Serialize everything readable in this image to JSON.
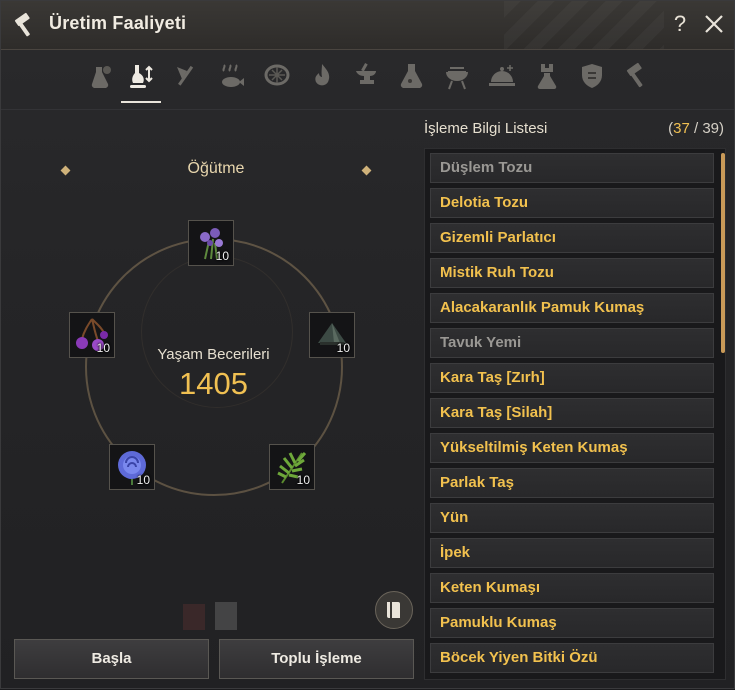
{
  "window": {
    "title": "Üretim Faaliyeti",
    "help_label": "?",
    "icon": "hammer-icon",
    "close_icon": "close-icon"
  },
  "tabs": [
    {
      "name": "simple-alchemy",
      "icon": "flask-bag-icon",
      "active": false
    },
    {
      "name": "grinding",
      "icon": "mortar-arrows-icon",
      "active": true
    },
    {
      "name": "chopping",
      "icon": "axe-icon",
      "active": false
    },
    {
      "name": "drying",
      "icon": "fish-steam-icon",
      "active": false
    },
    {
      "name": "filtering",
      "icon": "sieve-icon",
      "active": false
    },
    {
      "name": "heating",
      "icon": "flame-icon",
      "active": false
    },
    {
      "name": "repair",
      "icon": "anvil-icon",
      "active": false
    },
    {
      "name": "alchemy",
      "icon": "flask-icon",
      "active": false
    },
    {
      "name": "cooking",
      "icon": "grill-icon",
      "active": false
    },
    {
      "name": "guild-cooking",
      "icon": "cloche-icon",
      "active": false
    },
    {
      "name": "guild-alchemy",
      "icon": "tower-flask-icon",
      "active": false
    },
    {
      "name": "guild-manufacture",
      "icon": "shield-crest-icon",
      "active": false
    },
    {
      "name": "manufacture",
      "icon": "hammer-icon",
      "active": false
    }
  ],
  "process": {
    "name": "Öğütme",
    "life_skill_label": "Yaşam Becerileri",
    "life_skill_value": "1405"
  },
  "slots": [
    {
      "item": "purple-flower-sprig",
      "icon": "flower-icon",
      "qty": "10"
    },
    {
      "item": "dark-cone",
      "icon": "cone-icon",
      "qty": "10"
    },
    {
      "item": "fern-leaf",
      "icon": "leaf-icon",
      "qty": "10"
    },
    {
      "item": "blue-rose",
      "icon": "rose-icon",
      "qty": "10"
    },
    {
      "item": "purple-berries",
      "icon": "berry-icon",
      "qty": "10"
    }
  ],
  "buttons": {
    "start": "Başla",
    "bulk": "Toplu İşleme"
  },
  "list": {
    "header": "İşleme Bilgi Listesi",
    "count_open": "(",
    "count_current": "37",
    "count_sep": " / ",
    "count_total": "39",
    "count_close": ")",
    "items": [
      {
        "label": "Düşlem Tozu",
        "dim": true
      },
      {
        "label": "Delotia Tozu",
        "dim": false
      },
      {
        "label": "Gizemli Parlatıcı",
        "dim": false
      },
      {
        "label": "Mistik Ruh Tozu",
        "dim": false
      },
      {
        "label": "Alacakaranlık Pamuk Kumaş",
        "dim": false
      },
      {
        "label": "Tavuk Yemi",
        "dim": true
      },
      {
        "label": "Kara Taş [Zırh]",
        "dim": false
      },
      {
        "label": "Kara Taş [Silah]",
        "dim": false
      },
      {
        "label": "Yükseltilmiş Keten Kumaş",
        "dim": false
      },
      {
        "label": "Parlak Taş",
        "dim": false
      },
      {
        "label": "Yün",
        "dim": false
      },
      {
        "label": "İpek",
        "dim": false
      },
      {
        "label": "Keten Kumaşı",
        "dim": false
      },
      {
        "label": "Pamuklu Kumaş",
        "dim": false
      },
      {
        "label": "Böcek Yiyen Bitki Özü",
        "dim": false
      }
    ]
  },
  "colors": {
    "accent_gold": "#f0c052",
    "dim_text": "#9a9894",
    "scrollbar": "#c99a58"
  }
}
